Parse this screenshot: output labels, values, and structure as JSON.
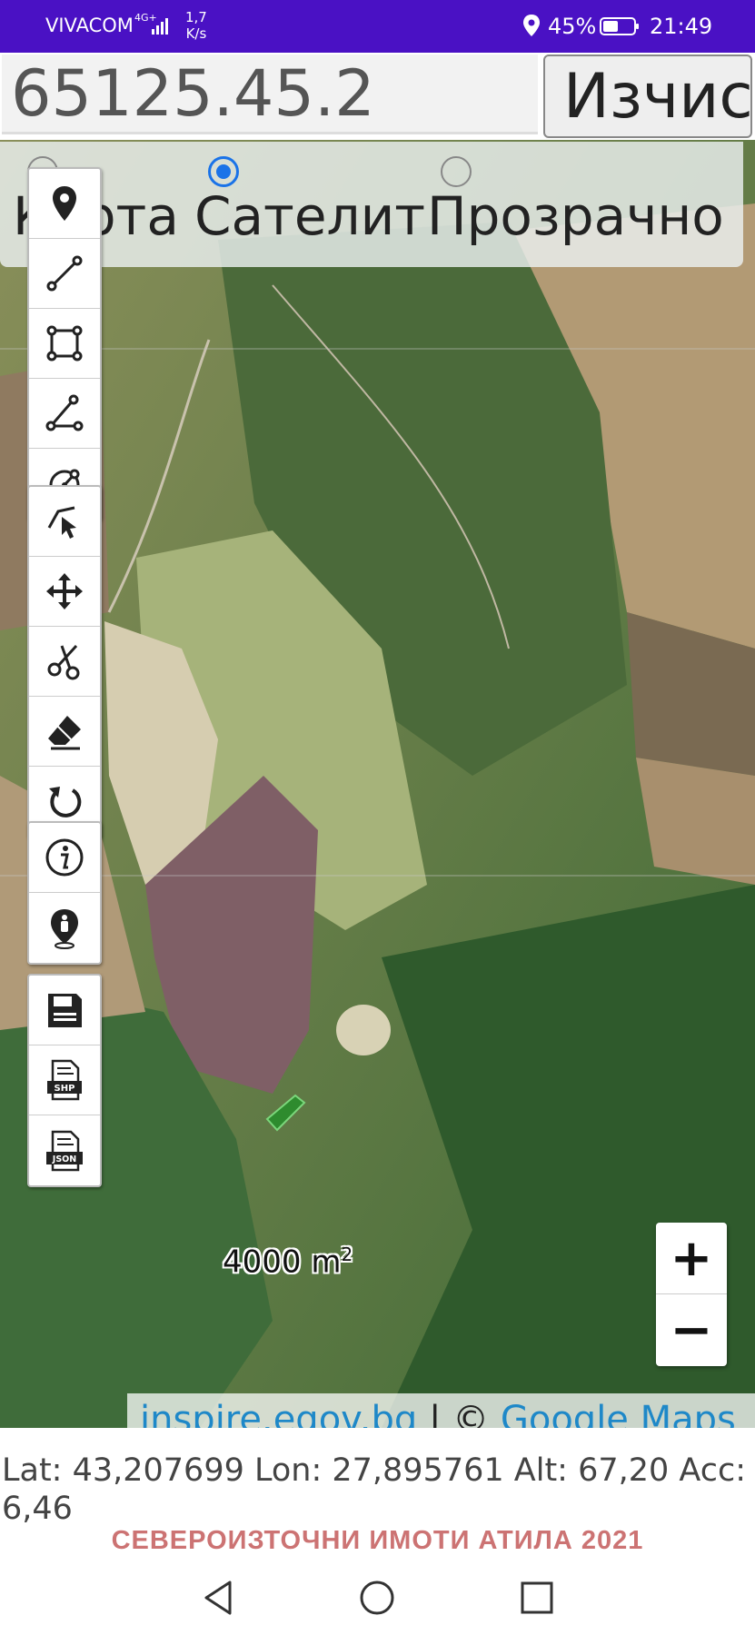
{
  "status_bar": {
    "carrier": "VIVACOM",
    "network": "4G+",
    "speed_value": "1,7",
    "speed_unit": "K/s",
    "battery_percent": "45%",
    "time": "21:49"
  },
  "search": {
    "value": "65125.45.2",
    "button_label": "Изчис"
  },
  "map_type": {
    "options": [
      "Карта",
      "Сателит",
      "Прозрачно"
    ],
    "selected": "Сателит"
  },
  "toolbar": {
    "group1": [
      "marker-icon",
      "line-icon",
      "polygon-icon",
      "angle-icon",
      "circle-icon"
    ],
    "group2": [
      "select-icon",
      "move-icon",
      "cut-icon",
      "eraser-icon",
      "undo-icon"
    ],
    "group3": [
      "info-icon",
      "person-location-icon"
    ],
    "group4": [
      "save-icon",
      "shp-export-icon",
      "json-export-icon"
    ],
    "shp_label": "SHP",
    "json_label": "JSON"
  },
  "map": {
    "area_label": "4000 m",
    "area_unit_sup": "2",
    "attribution_link1": "inspire.egov.bg",
    "attribution_sep": " | © ",
    "attribution_link2": "Google Maps"
  },
  "zoom": {
    "plus": "+",
    "minus": "−"
  },
  "location": {
    "text": "Lat: 43,207699 Lon: 27,895761 Alt: 67,20 Acc: 6,46"
  },
  "footer": {
    "brand": "СЕВЕРОИЗТОЧНИ ИМОТИ АТИЛА 2021"
  }
}
